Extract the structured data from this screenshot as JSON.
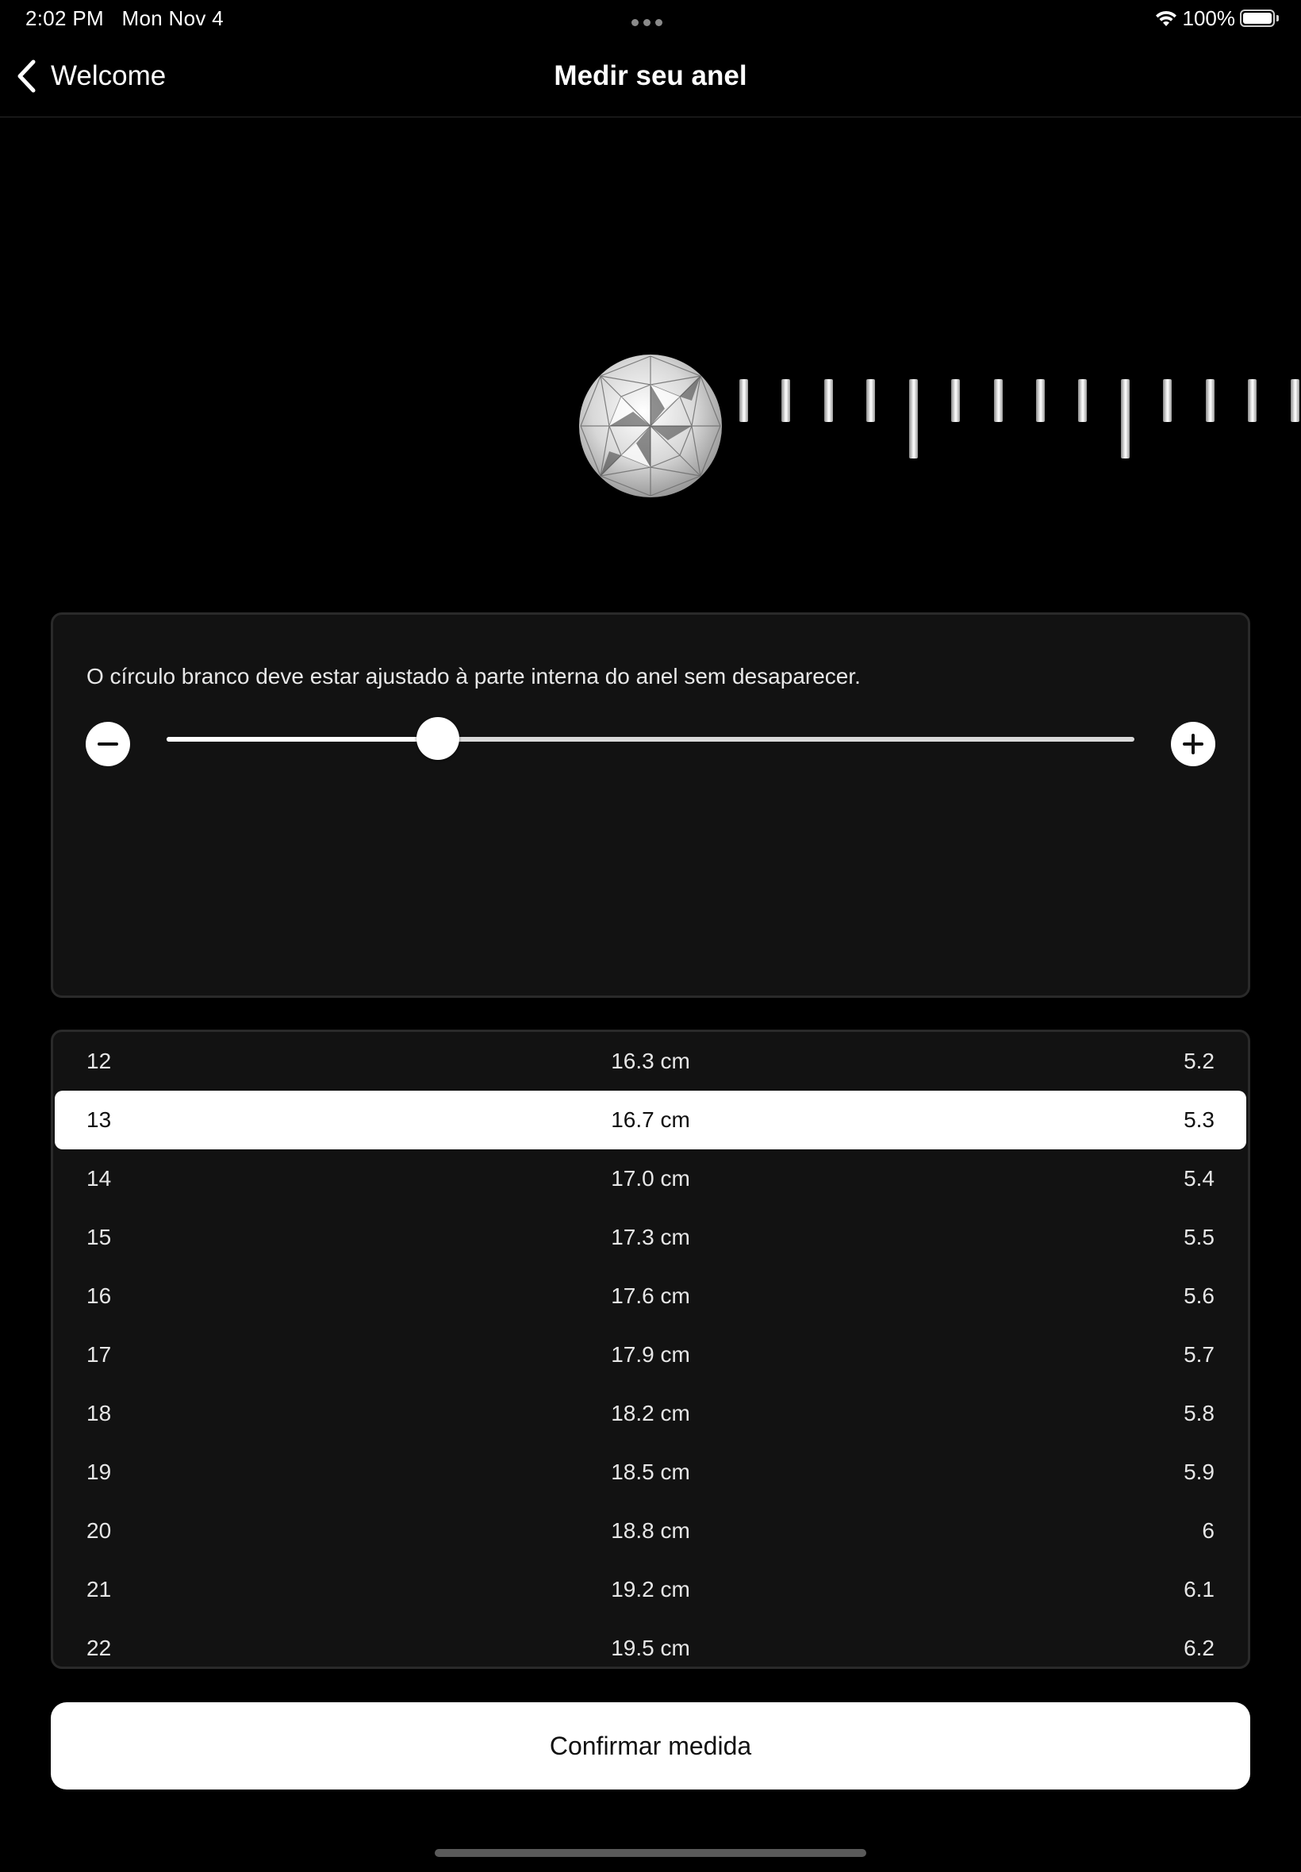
{
  "status_bar": {
    "time": "2:02 PM",
    "date": "Mon Nov 4",
    "battery": "100%",
    "icons": [
      "more-dots-icon",
      "wifi-icon",
      "battery-icon"
    ]
  },
  "nav": {
    "back_label": "Welcome",
    "back_icon": "chevron-left-icon",
    "title": "Medir seu anel"
  },
  "ruler": {
    "ring_icon": "diamond-icon"
  },
  "controls": {
    "instruction": "O círculo branco deve estar ajustado à parte interna do anel sem desaparecer.",
    "decrease_icon": "minus-icon",
    "increase_icon": "plus-icon",
    "slider_value_fraction": 0.28
  },
  "size_table": {
    "selected_index": 1,
    "rows": [
      {
        "size": "12",
        "circumference": "16.3 cm",
        "diameter": "5.2"
      },
      {
        "size": "13",
        "circumference": "16.7 cm",
        "diameter": "5.3"
      },
      {
        "size": "14",
        "circumference": "17.0 cm",
        "diameter": "5.4"
      },
      {
        "size": "15",
        "circumference": "17.3 cm",
        "diameter": "5.5"
      },
      {
        "size": "16",
        "circumference": "17.6 cm",
        "diameter": "5.6"
      },
      {
        "size": "17",
        "circumference": "17.9 cm",
        "diameter": "5.7"
      },
      {
        "size": "18",
        "circumference": "18.2 cm",
        "diameter": "5.8"
      },
      {
        "size": "19",
        "circumference": "18.5 cm",
        "diameter": "5.9"
      },
      {
        "size": "20",
        "circumference": "18.8 cm",
        "diameter": "6"
      },
      {
        "size": "21",
        "circumference": "19.2 cm",
        "diameter": "6.1"
      },
      {
        "size": "22",
        "circumference": "19.5 cm",
        "diameter": "6.2"
      }
    ]
  },
  "confirm": {
    "label": "Confirmar medida"
  },
  "colors": {
    "background": "#000000",
    "panel": "#121212",
    "panel_border": "#2a2a2a",
    "accent": "#ffffff"
  }
}
